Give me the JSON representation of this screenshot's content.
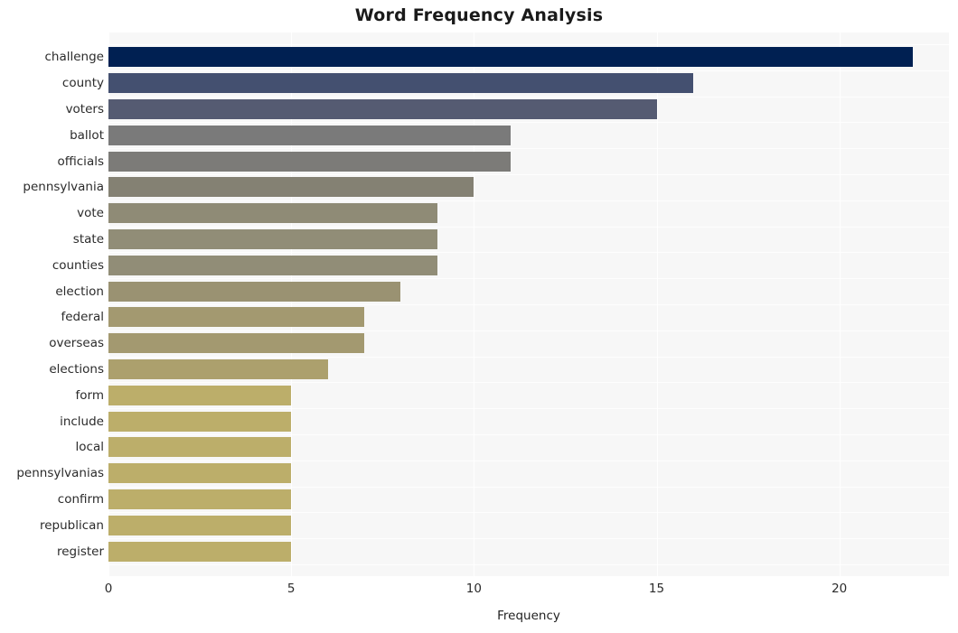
{
  "chart_data": {
    "type": "bar",
    "orientation": "horizontal",
    "title": "Word Frequency Analysis",
    "xlabel": "Frequency",
    "ylabel": "",
    "xlim": [
      0,
      23
    ],
    "ylim": null,
    "grid": true,
    "legend": null,
    "xticks": [
      0,
      5,
      10,
      15,
      20
    ],
    "xtick_labels": [
      "0",
      "5",
      "10",
      "15",
      "20"
    ],
    "categories": [
      "challenge",
      "county",
      "voters",
      "ballot",
      "officials",
      "pennsylvania",
      "vote",
      "state",
      "counties",
      "election",
      "federal",
      "overseas",
      "elections",
      "form",
      "include",
      "local",
      "pennsylvanias",
      "confirm",
      "republican",
      "register"
    ],
    "values": [
      22,
      16,
      15,
      11,
      11,
      10,
      9,
      9,
      9,
      8,
      7,
      7,
      6,
      5,
      5,
      5,
      5,
      5,
      5,
      5
    ],
    "bar_colors": [
      "#002052",
      "#445070",
      "#555b72",
      "#7a7a7a",
      "#7c7b78",
      "#848173",
      "#8f8b76",
      "#918d77",
      "#918d77",
      "#9a9272",
      "#a39970",
      "#a39970",
      "#aca06d",
      "#bcae6a",
      "#bcae6a",
      "#bcae6a",
      "#bcae6a",
      "#bcae6a",
      "#bcae6a",
      "#bcae6a"
    ],
    "plot_background": "#f7f7f7",
    "gridline_color": "#ffffff",
    "page_background": "#ffffff",
    "text_color": "#2b2b2b"
  }
}
